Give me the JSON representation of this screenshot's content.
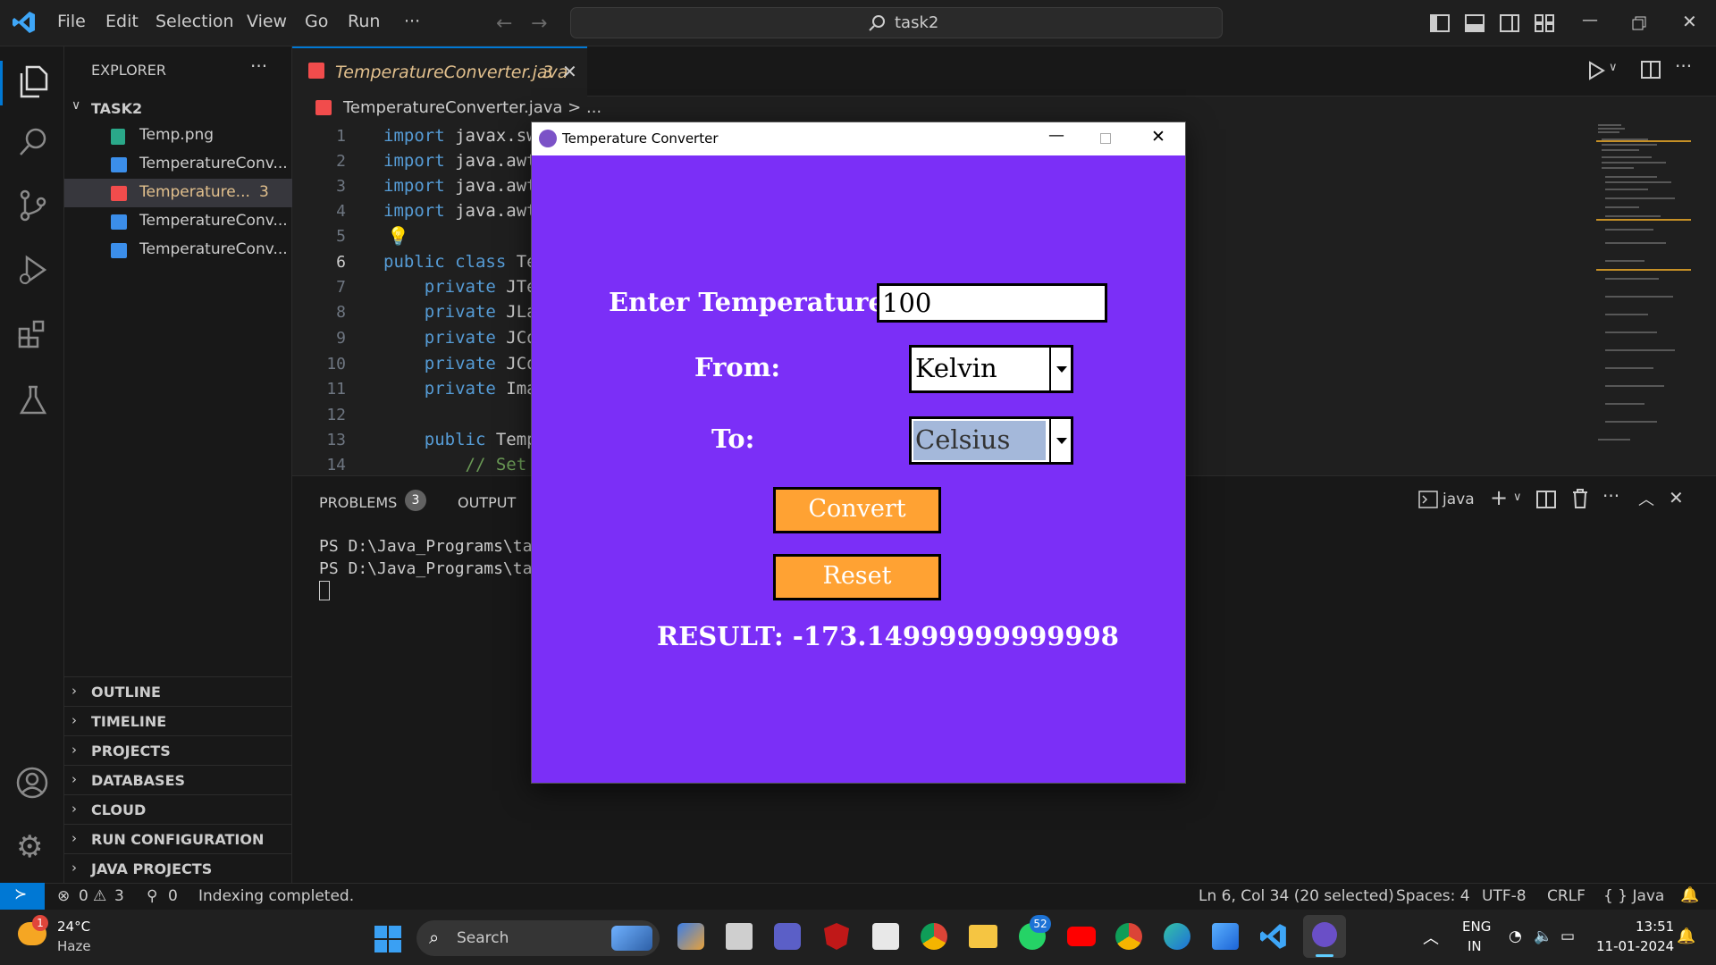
{
  "menu": [
    "File",
    "Edit",
    "Selection",
    "View",
    "Go",
    "Run",
    "···"
  ],
  "search": {
    "label": "task2"
  },
  "explorer": {
    "title": "EXPLORER",
    "folder": "TASK2",
    "files": [
      {
        "name": "Temp.png",
        "icon": "image-file-icon"
      },
      {
        "name": "TemperatureConv...",
        "icon": "java-file-icon"
      },
      {
        "name": "Temperature...",
        "badge": "3",
        "icon": "java-file-icon",
        "selected": true
      },
      {
        "name": "TemperatureConv...",
        "icon": "java-file-icon"
      },
      {
        "name": "TemperatureConv...",
        "icon": "java-file-icon"
      }
    ],
    "sections": [
      "OUTLINE",
      "TIMELINE",
      "PROJECTS",
      "DATABASES",
      "CLOUD",
      "RUN CONFIGURATION",
      "JAVA PROJECTS"
    ]
  },
  "editor": {
    "tab": {
      "label": "TemperatureConverter.java",
      "badge": "3"
    },
    "breadcrumb": "TemperatureConverter.java > ...",
    "lines": [
      {
        "n": "1",
        "kw": "import",
        "rest": " javax.sw"
      },
      {
        "n": "2",
        "kw": "import",
        "rest": " java.awt"
      },
      {
        "n": "3",
        "kw": "import",
        "rest": " java.awt"
      },
      {
        "n": "4",
        "kw": "import",
        "rest": " java.awt"
      },
      {
        "n": "5",
        "kw": "",
        "rest": ""
      },
      {
        "n": "6",
        "kw": "public class",
        "rest": " Te"
      },
      {
        "n": "7",
        "kw": "    private",
        "rest": " JTe"
      },
      {
        "n": "8",
        "kw": "    private",
        "rest": " JLa"
      },
      {
        "n": "9",
        "kw": "    private",
        "rest": " JCo"
      },
      {
        "n": "10",
        "kw": "    private",
        "rest": " JCo"
      },
      {
        "n": "11",
        "kw": "    private",
        "rest": " Ima"
      },
      {
        "n": "12",
        "kw": "",
        "rest": ""
      },
      {
        "n": "13",
        "kw": "    public",
        "rest": " Temp"
      },
      {
        "n": "14",
        "kw": "",
        "rest": "        // Set"
      }
    ]
  },
  "panel": {
    "tabs": [
      {
        "label": "PROBLEMS",
        "badge": "3"
      },
      {
        "label": "OUTPUT"
      }
    ],
    "terminal_name": "java",
    "lines": [
      "PS D:\\Java_Programs\\ta",
      "PS D:\\Java_Programs\\ta"
    ]
  },
  "status": {
    "errors": "0",
    "warnings": "3",
    "ports": "0",
    "message": "Indexing completed.",
    "position": "Ln 6, Col 34 (20 selected)",
    "spaces": "Spaces: 4",
    "encoding": "UTF-8",
    "eol": "CRLF",
    "language": "{ } Java"
  },
  "taskbar": {
    "weather": {
      "temp": "24°C",
      "cond": "Haze",
      "badge": "1"
    },
    "search": "Search",
    "whatsapp_badge": "52",
    "lang": {
      "top": "ENG",
      "bottom": "IN"
    },
    "time": "13:51",
    "date": "11-01-2024"
  },
  "app": {
    "title": "Temperature Converter",
    "enter_label": "Enter Temperature:",
    "value": "100",
    "from_label": "From:",
    "from_value": "Kelvin",
    "to_label": "To:",
    "to_value": "Celsius",
    "convert": "Convert",
    "reset": "Reset",
    "result": "RESULT: -173.14999999999998",
    "bg_color": "#7b2ff7",
    "button_color": "#ffa233"
  }
}
